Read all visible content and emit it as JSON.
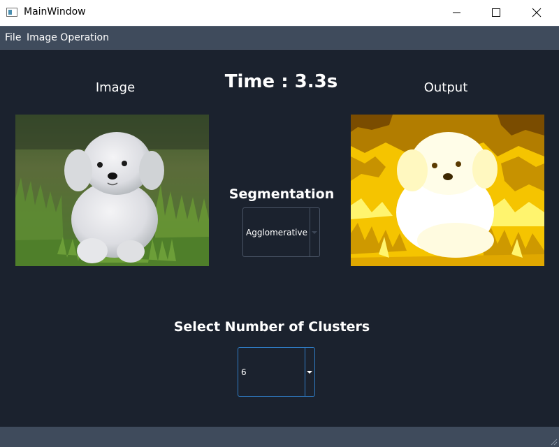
{
  "window": {
    "title": "MainWindow",
    "icon": "app-window-icon",
    "controls": [
      "minimize-icon",
      "maximize-icon",
      "close-icon"
    ]
  },
  "menu": {
    "items": [
      {
        "label": "File"
      },
      {
        "label": "Image Operation"
      }
    ]
  },
  "labels": {
    "image": "Image",
    "output": "Output",
    "time": "Time : 3.3s",
    "segmentation": "Segmentation",
    "clusters": "Select Number of Clusters"
  },
  "segmentation_select": {
    "value": "Agglomerative"
  },
  "clusters_select": {
    "value": "6"
  },
  "colors": {
    "background": "#1b222e",
    "menubar": "#3f4b5c",
    "focus_border": "#2f7cc4",
    "text": "#ffffff"
  },
  "images": {
    "input": "white puppy in grass photo",
    "output": "segmented puppy in yellow clusters"
  }
}
